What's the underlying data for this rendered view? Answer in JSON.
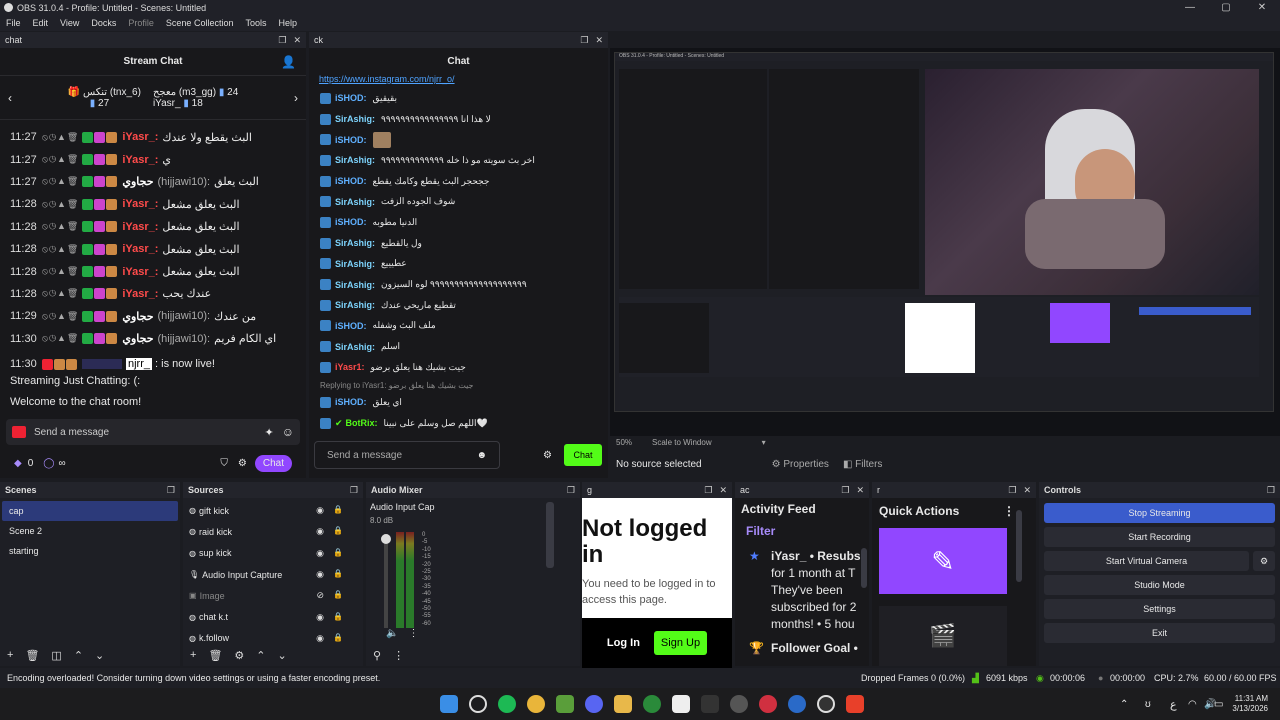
{
  "window": {
    "title": "OBS 31.0.4 - Profile: Untitled - Scenes: Untitled",
    "min": "—",
    "max": "▢",
    "close": "✕"
  },
  "menu": [
    "File",
    "Edit",
    "View",
    "Docks",
    "Profile",
    "Scene Collection",
    "Tools",
    "Help"
  ],
  "chat_dock": {
    "title": "chat",
    "header": "Stream Chat",
    "gifters": [
      {
        "name": "تنكس (tnx_6)",
        "count": "27"
      },
      {
        "name": "معجح (m3_gg)",
        "count": "24"
      },
      {
        "name": "iYasr_",
        "count": "18"
      }
    ],
    "messages": [
      {
        "time": "11:27",
        "user": "iYasr_:",
        "text": "البث يقطع ولا عندك",
        "color": "#ff4b4b"
      },
      {
        "time": "11:27",
        "user": "iYasr_:",
        "text": "ي",
        "color": "#ff4b4b"
      },
      {
        "time": "11:27",
        "user": "حجاوي",
        "handle": "(hijjawi10):",
        "text": "البث يعلق",
        "color": "#ffffff"
      },
      {
        "time": "11:28",
        "user": "iYasr_:",
        "text": "البث يعلق مشعل",
        "color": "#ff4b4b"
      },
      {
        "time": "11:28",
        "user": "iYasr_:",
        "text": "البث يعلق مشعل",
        "color": "#ff4b4b"
      },
      {
        "time": "11:28",
        "user": "iYasr_:",
        "text": "البث يعلق مشعل",
        "color": "#ff4b4b"
      },
      {
        "time": "11:28",
        "user": "iYasr_:",
        "text": "البث يعلق مشعل",
        "color": "#ff4b4b"
      },
      {
        "time": "11:28",
        "user": "iYasr_:",
        "text": "عندك يحب",
        "color": "#ff4b4b"
      },
      {
        "time": "11:29",
        "user": "حجاوي",
        "handle": "(hijjawi10):",
        "text": "من عندك",
        "color": "#ffffff"
      },
      {
        "time": "11:30",
        "user": "حجاوي",
        "handle": "(hijjawi10):",
        "text": "اي الكام فريم",
        "color": "#ffffff"
      }
    ],
    "live_time": "11:30",
    "live_user": "njrr_",
    "live_text": ": is now live!",
    "line1": "Streaming Just Chatting: (:",
    "line2": "Welcome to the chat room!",
    "send_placeholder": "Send a message",
    "points": "0",
    "infinity": "∞",
    "chat_button": "Chat"
  },
  "ck_dock": {
    "title": "ck",
    "header": "Chat",
    "link": "https://www.instagram.com/njrr_o/",
    "messages": [
      {
        "user": "iSHOD:",
        "text": "بقيقيق",
        "color": "#5fb0ff"
      },
      {
        "user": "SirAshig:",
        "text": "لا هذا انا ٩٩٩٩٩٩٩٩٩٩٩٩٩٩٩٩",
        "color": "#7dd3fc"
      },
      {
        "user": "iSHOD:",
        "text": "",
        "color": "#5fb0ff"
      },
      {
        "user": "SirAshig:",
        "text": "اخر بث سويته مو ذا خله ٩٩٩٩٩٩٩٩٩٩٩٩٩",
        "color": "#7dd3fc"
      },
      {
        "user": "iSHOD:",
        "text": "ججحجر البث يقطع وكامك يقطع",
        "color": "#5fb0ff"
      },
      {
        "user": "SirAshig:",
        "text": "شوف الجوده الزفت",
        "color": "#7dd3fc"
      },
      {
        "user": "iSHOD:",
        "text": "الدنيا مطوبه",
        "color": "#5fb0ff"
      },
      {
        "user": "SirAshig:",
        "text": "ول يالقطيع",
        "color": "#7dd3fc"
      },
      {
        "user": "SirAshig:",
        "text": "عطيييع",
        "color": "#7dd3fc"
      },
      {
        "user": "SirAshig:",
        "text": "٩٩٩٩٩٩٩٩٩٩٩٩٩٩٩٩٩٩٩٩ لوه السيزون",
        "color": "#7dd3fc"
      },
      {
        "user": "SirAshig:",
        "text": "تقطيع ماريحي عندك",
        "color": "#7dd3fc"
      },
      {
        "user": "iSHOD:",
        "text": "ملف البث وشفله",
        "color": "#5fb0ff"
      },
      {
        "user": "SirAshig:",
        "text": "اسلم",
        "color": "#7dd3fc"
      },
      {
        "user": "iYasr1:",
        "text": "جيت بشيك هنا يعلق برضو",
        "color": "#ff4b4b"
      }
    ],
    "reply_label": "Replying to iYasr1: جيت بشيك هنا يعلق برضو",
    "reply_user": "iSHOD:",
    "reply_text": "اي يعلق",
    "bot_user": "BotRix:",
    "bot_text": "اللهم صل وسلم على نبينا🤍",
    "send_placeholder": "Send a message",
    "chat_button": "Chat"
  },
  "preview": {
    "zoom": "50%",
    "scale_mode": "Scale to Window",
    "no_source": "No source selected",
    "properties": "Properties",
    "filters": "Filters"
  },
  "scenes": {
    "title": "Scenes",
    "items": [
      "cap",
      "Scene 2",
      "starting"
    ]
  },
  "sources": {
    "title": "Sources",
    "items": [
      "gift kick",
      "raid kick",
      "sup kick",
      "Audio Input Capture",
      "Image",
      "chat k.t",
      "k.follow"
    ]
  },
  "mixer": {
    "title": "Audio Mixer",
    "track": "Audio Input Cap",
    "db": "8.0 dB",
    "scale": [
      "0",
      "-5",
      "-10",
      "-15",
      "-20",
      "-25",
      "-30",
      "-35",
      "-40",
      "-45",
      "-50",
      "-55",
      "-60"
    ]
  },
  "g_dock": {
    "title": "g",
    "heading": "Not logged in",
    "desc": "You need to be logged in to access this page.",
    "login": "Log In",
    "signup": "Sign Up"
  },
  "ac_dock": {
    "title": "ac",
    "heading": "Activity Feed",
    "filter": "Filter",
    "event_user": "iYasr_ • Resubs",
    "event_lines": [
      "for 1 month at T",
      "They've been",
      "subscribed for 2",
      "months! • 5 hou"
    ],
    "follower_goal": "Follower Goal •"
  },
  "r_dock": {
    "title": "r",
    "heading": "Quick Actions"
  },
  "controls": {
    "title": "Controls",
    "buttons": [
      "Stop Streaming",
      "Start Recording",
      "Start Virtual Camera",
      "Studio Mode",
      "Settings",
      "Exit"
    ]
  },
  "status": {
    "message": "Encoding overloaded! Consider turning down video settings or using a faster encoding preset.",
    "dropped": "Dropped Frames 0 (0.0%)",
    "bitrate": "6091 kbps",
    "stream_time": "00:00:06",
    "rec_time": "00:00:00",
    "cpu": "CPU: 2.7%",
    "fps": "60.00 / 60.00 FPS"
  },
  "taskbar": {
    "time": "11:31 AM",
    "date": "3/13/2026",
    "lang": "ع"
  },
  "colors": {
    "accent": "#9147ff",
    "green": "#53fc18",
    "stop": "#3a5ccc"
  }
}
